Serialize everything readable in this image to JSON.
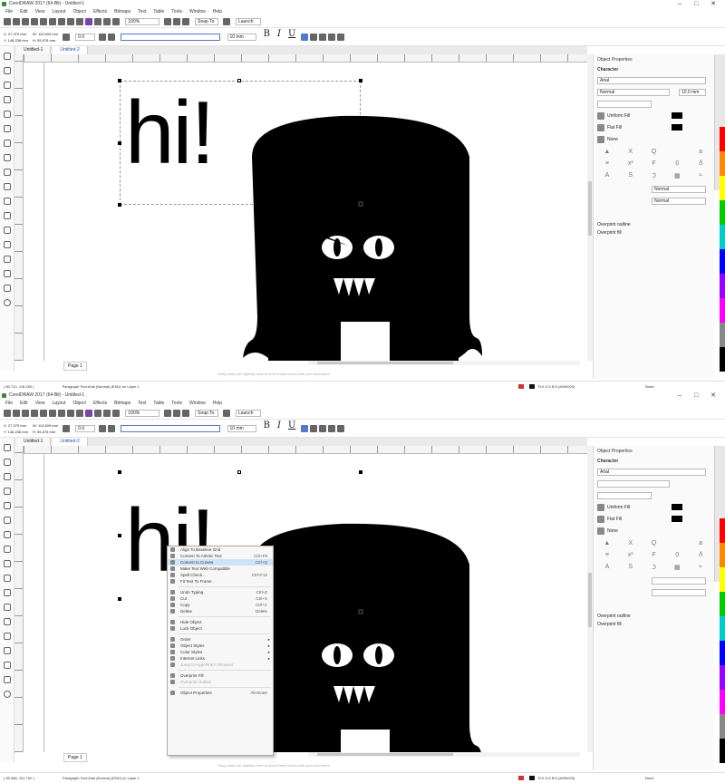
{
  "app": {
    "title": "CorelDRAW 2017 (64-Bit) - Untitled-1",
    "window_buttons": [
      "–",
      "□",
      "✕"
    ]
  },
  "menu": [
    "File",
    "Edit",
    "View",
    "Layout",
    "Object",
    "Effects",
    "Bitmaps",
    "Text",
    "Table",
    "Tools",
    "Window",
    "Help"
  ],
  "toolbar": {
    "zoom": "100%",
    "snap_to": "Snap To",
    "launch": "Launch"
  },
  "propbar": {
    "x": "X: 27.375 mm",
    "y": "Y: 148.238 mm",
    "w": "W: 113.609 mm",
    "h": "H: 55.078 mm",
    "angle": "0.0",
    "size": "10 mm",
    "bold": "B",
    "italic": "I",
    "underline": "U"
  },
  "tabs": [
    "Untitled-1",
    "Untitled-2"
  ],
  "canvas": {
    "text": "hi!",
    "page_label": "Page 1",
    "hint": "Drag colors (or objects) here to store these colors with your document"
  },
  "statusbar_top": {
    "coords": "( 80.710, 118.255 )",
    "object": "Paragraph Text:Arial (Normal) (ENU) on Layer 1",
    "fill": "R:0 G:0 B:0 (#000000)",
    "outline": "None"
  },
  "statusbar_bottom": {
    "coords": "( 59.466, 151.700 )",
    "object": "Paragraph Text:Arial (Normal) (ENU) on Layer 1",
    "fill": "R:0 G:0 B:0 (#000000)",
    "outline": "None"
  },
  "docker": {
    "title": "Object Properties",
    "section": "Character",
    "font": "Arial",
    "style": "Normal",
    "size": "10.0 mm",
    "fill1": "Uniform Fill",
    "fill2": "Flat Fill",
    "fill3": "None",
    "normal1": "Normal",
    "normal2": "Normal",
    "overprint_outline": "Overprint outline",
    "overprint_fill": "Overprint fill"
  },
  "context_menu": {
    "items": [
      {
        "label": "Align To Baseline Grid",
        "shortcut": "",
        "type": "item"
      },
      {
        "label": "Convert To Artistic Text",
        "shortcut": "Ctrl+F8",
        "type": "item"
      },
      {
        "label": "Convert to Curves",
        "shortcut": "Ctrl+Q",
        "type": "highlight"
      },
      {
        "label": "Make Text Web Compatible",
        "shortcut": "",
        "type": "item"
      },
      {
        "label": "Spell Check...",
        "shortcut": "Ctrl+F12",
        "type": "item"
      },
      {
        "label": "Fit Text To Frame",
        "shortcut": "",
        "type": "item"
      },
      {
        "label": "",
        "shortcut": "",
        "type": "sep"
      },
      {
        "label": "Undo Typing",
        "shortcut": "Ctrl+Z",
        "type": "item"
      },
      {
        "label": "Cut",
        "shortcut": "Ctrl+X",
        "type": "item"
      },
      {
        "label": "Copy",
        "shortcut": "Ctrl+C",
        "type": "item"
      },
      {
        "label": "Delete",
        "shortcut": "Delete",
        "type": "item"
      },
      {
        "label": "",
        "shortcut": "",
        "type": "sep"
      },
      {
        "label": "Hide Object",
        "shortcut": "",
        "type": "item"
      },
      {
        "label": "Lock Object",
        "shortcut": "",
        "type": "item"
      },
      {
        "label": "",
        "shortcut": "",
        "type": "sep"
      },
      {
        "label": "Order",
        "shortcut": "",
        "type": "submenu"
      },
      {
        "label": "Object Styles",
        "shortcut": "",
        "type": "submenu"
      },
      {
        "label": "Color Styles",
        "shortcut": "",
        "type": "submenu"
      },
      {
        "label": "Internet Links",
        "shortcut": "",
        "type": "submenu"
      },
      {
        "label": "Jump to Hyperlink in Browser",
        "shortcut": "",
        "type": "disabled"
      },
      {
        "label": "",
        "shortcut": "",
        "type": "sep"
      },
      {
        "label": "Overprint Fill",
        "shortcut": "",
        "type": "item"
      },
      {
        "label": "Overprint Outline",
        "shortcut": "",
        "type": "disabled"
      },
      {
        "label": "",
        "shortcut": "",
        "type": "sep"
      },
      {
        "label": "Object Properties",
        "shortcut": "Alt+Enter",
        "type": "item"
      }
    ]
  }
}
